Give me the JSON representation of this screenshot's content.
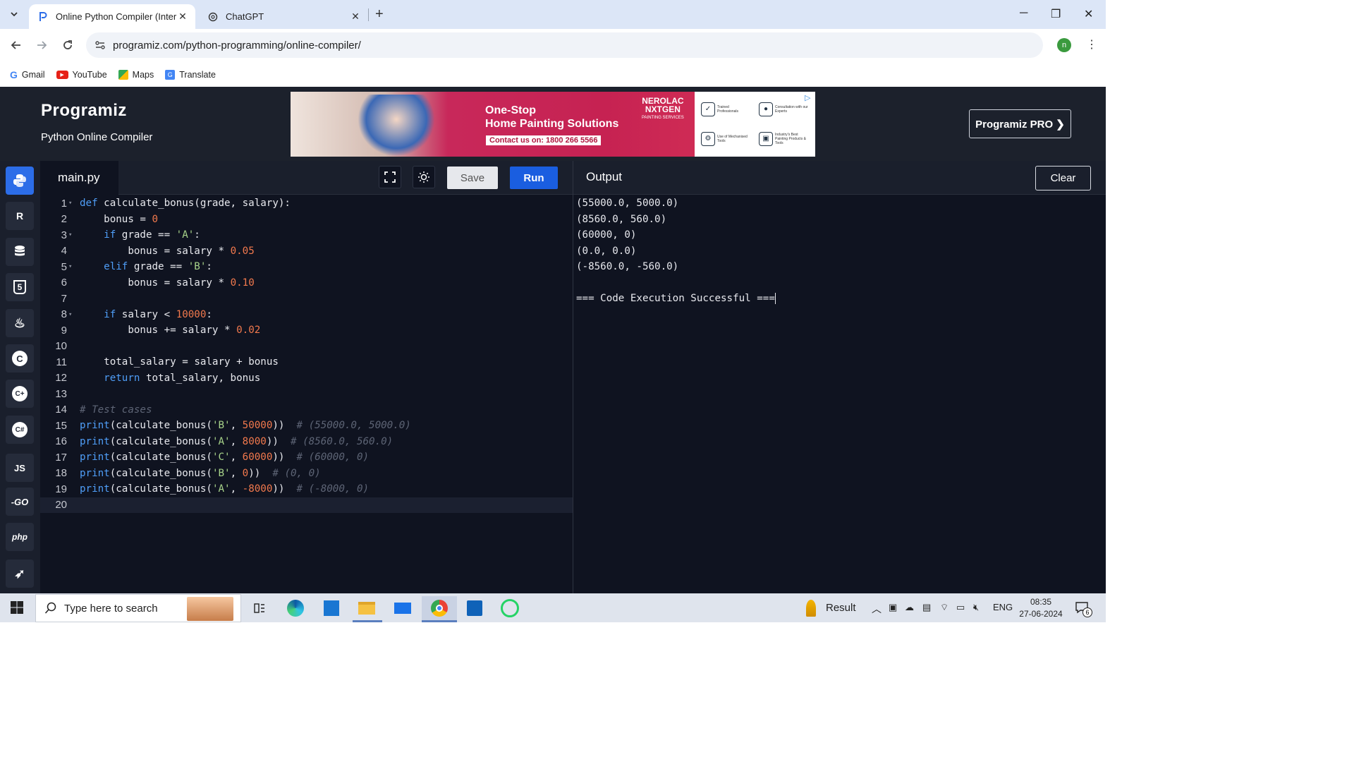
{
  "browser": {
    "tabs": [
      {
        "title": "Online Python Compiler (Interp",
        "active": true
      },
      {
        "title": "ChatGPT",
        "active": false
      }
    ],
    "address": "programiz.com/python-programming/online-compiler/",
    "profile_initial": "n",
    "bookmarks": [
      "Gmail",
      "YouTube",
      "Maps",
      "Translate"
    ]
  },
  "header": {
    "logo": "Programiz",
    "subtitle": "Python Online Compiler",
    "pro_button": "Programiz PRO ❯"
  },
  "ad": {
    "headline1": "One-Stop",
    "headline2": "Home Painting Solutions",
    "contact": "Contact us on: 1800 266 5566",
    "brand1": "NEROLAC",
    "brand2": "NXTGEN",
    "brand3": "PAINTING SERVICES",
    "features": [
      "Trained Professionals",
      "Consultation with our Experts",
      "Use of Mechanised Tools",
      "Industry's Best Painting Products & Tools"
    ]
  },
  "languages": [
    "Python",
    "R",
    "SQL",
    "HTML",
    "Java",
    "C",
    "C++",
    "C#",
    "JS",
    "GO",
    "php",
    "Swift"
  ],
  "editor": {
    "filename": "main.py",
    "save_label": "Save",
    "run_label": "Run",
    "lines": [
      {
        "n": "1",
        "fold": true
      },
      {
        "n": "2"
      },
      {
        "n": "3",
        "fold": true
      },
      {
        "n": "4"
      },
      {
        "n": "5",
        "fold": true
      },
      {
        "n": "6"
      },
      {
        "n": "7"
      },
      {
        "n": "8",
        "fold": true
      },
      {
        "n": "9"
      },
      {
        "n": "10"
      },
      {
        "n": "11"
      },
      {
        "n": "12"
      },
      {
        "n": "13"
      },
      {
        "n": "14"
      },
      {
        "n": "15"
      },
      {
        "n": "16"
      },
      {
        "n": "17"
      },
      {
        "n": "18"
      },
      {
        "n": "19"
      },
      {
        "n": "20"
      }
    ],
    "code": [
      [
        [
          "kw",
          "def "
        ],
        [
          "tx",
          "calculate_bonus(grade, salary):"
        ]
      ],
      [
        [
          "tx",
          "    bonus "
        ],
        [
          "op",
          "= "
        ],
        [
          "num",
          "0"
        ]
      ],
      [
        [
          "kw",
          "    if "
        ],
        [
          "tx",
          "grade "
        ],
        [
          "op",
          "== "
        ],
        [
          "str",
          "'A'"
        ],
        [
          "tx",
          ":"
        ]
      ],
      [
        [
          "tx",
          "        bonus "
        ],
        [
          "op",
          "= "
        ],
        [
          "tx",
          "salary "
        ],
        [
          "op",
          "* "
        ],
        [
          "num",
          "0.05"
        ]
      ],
      [
        [
          "kw",
          "    elif "
        ],
        [
          "tx",
          "grade "
        ],
        [
          "op",
          "== "
        ],
        [
          "str",
          "'B'"
        ],
        [
          "tx",
          ":"
        ]
      ],
      [
        [
          "tx",
          "        bonus "
        ],
        [
          "op",
          "= "
        ],
        [
          "tx",
          "salary "
        ],
        [
          "op",
          "* "
        ],
        [
          "num",
          "0.10"
        ]
      ],
      [],
      [
        [
          "kw",
          "    if "
        ],
        [
          "tx",
          "salary "
        ],
        [
          "op",
          "< "
        ],
        [
          "num",
          "10000"
        ],
        [
          "tx",
          ":"
        ]
      ],
      [
        [
          "tx",
          "        bonus "
        ],
        [
          "op",
          "+= "
        ],
        [
          "tx",
          "salary "
        ],
        [
          "op",
          "* "
        ],
        [
          "num",
          "0.02"
        ]
      ],
      [],
      [
        [
          "tx",
          "    total_salary "
        ],
        [
          "op",
          "= "
        ],
        [
          "tx",
          "salary "
        ],
        [
          "op",
          "+ "
        ],
        [
          "tx",
          "bonus"
        ]
      ],
      [
        [
          "kw",
          "    return "
        ],
        [
          "tx",
          "total_salary, bonus"
        ]
      ],
      [],
      [
        [
          "cm",
          "# Test cases"
        ]
      ],
      [
        [
          "kw",
          "print"
        ],
        [
          "tx",
          "(calculate_bonus("
        ],
        [
          "str",
          "'B'"
        ],
        [
          "tx",
          ", "
        ],
        [
          "num",
          "50000"
        ],
        [
          "tx",
          "))  "
        ],
        [
          "cm",
          "# (55000.0, 5000.0)"
        ]
      ],
      [
        [
          "kw",
          "print"
        ],
        [
          "tx",
          "(calculate_bonus("
        ],
        [
          "str",
          "'A'"
        ],
        [
          "tx",
          ", "
        ],
        [
          "num",
          "8000"
        ],
        [
          "tx",
          "))  "
        ],
        [
          "cm",
          "# (8560.0, 560.0)"
        ]
      ],
      [
        [
          "kw",
          "print"
        ],
        [
          "tx",
          "(calculate_bonus("
        ],
        [
          "str",
          "'C'"
        ],
        [
          "tx",
          ", "
        ],
        [
          "num",
          "60000"
        ],
        [
          "tx",
          "))  "
        ],
        [
          "cm",
          "# (60000, 0)"
        ]
      ],
      [
        [
          "kw",
          "print"
        ],
        [
          "tx",
          "(calculate_bonus("
        ],
        [
          "str",
          "'B'"
        ],
        [
          "tx",
          ", "
        ],
        [
          "num",
          "0"
        ],
        [
          "tx",
          "))  "
        ],
        [
          "cm",
          "# (0, 0)"
        ]
      ],
      [
        [
          "kw",
          "print"
        ],
        [
          "tx",
          "(calculate_bonus("
        ],
        [
          "str",
          "'A'"
        ],
        [
          "tx",
          ", "
        ],
        [
          "num",
          "-8000"
        ],
        [
          "tx",
          "))  "
        ],
        [
          "cm",
          "# (-8000, 0)"
        ]
      ],
      []
    ]
  },
  "output": {
    "title": "Output",
    "clear_label": "Clear",
    "lines": [
      "(55000.0, 5000.0)",
      "(8560.0, 560.0)",
      "(60000, 0)",
      "(0.0, 0.0)",
      "(-8560.0, -560.0)",
      "",
      "=== Code Execution Successful ==="
    ]
  },
  "taskbar": {
    "search_placeholder": "Type here to search",
    "result_label": "Result",
    "language": "ENG",
    "time": "08:35",
    "date": "27-06-2024",
    "notification_count": "6"
  }
}
